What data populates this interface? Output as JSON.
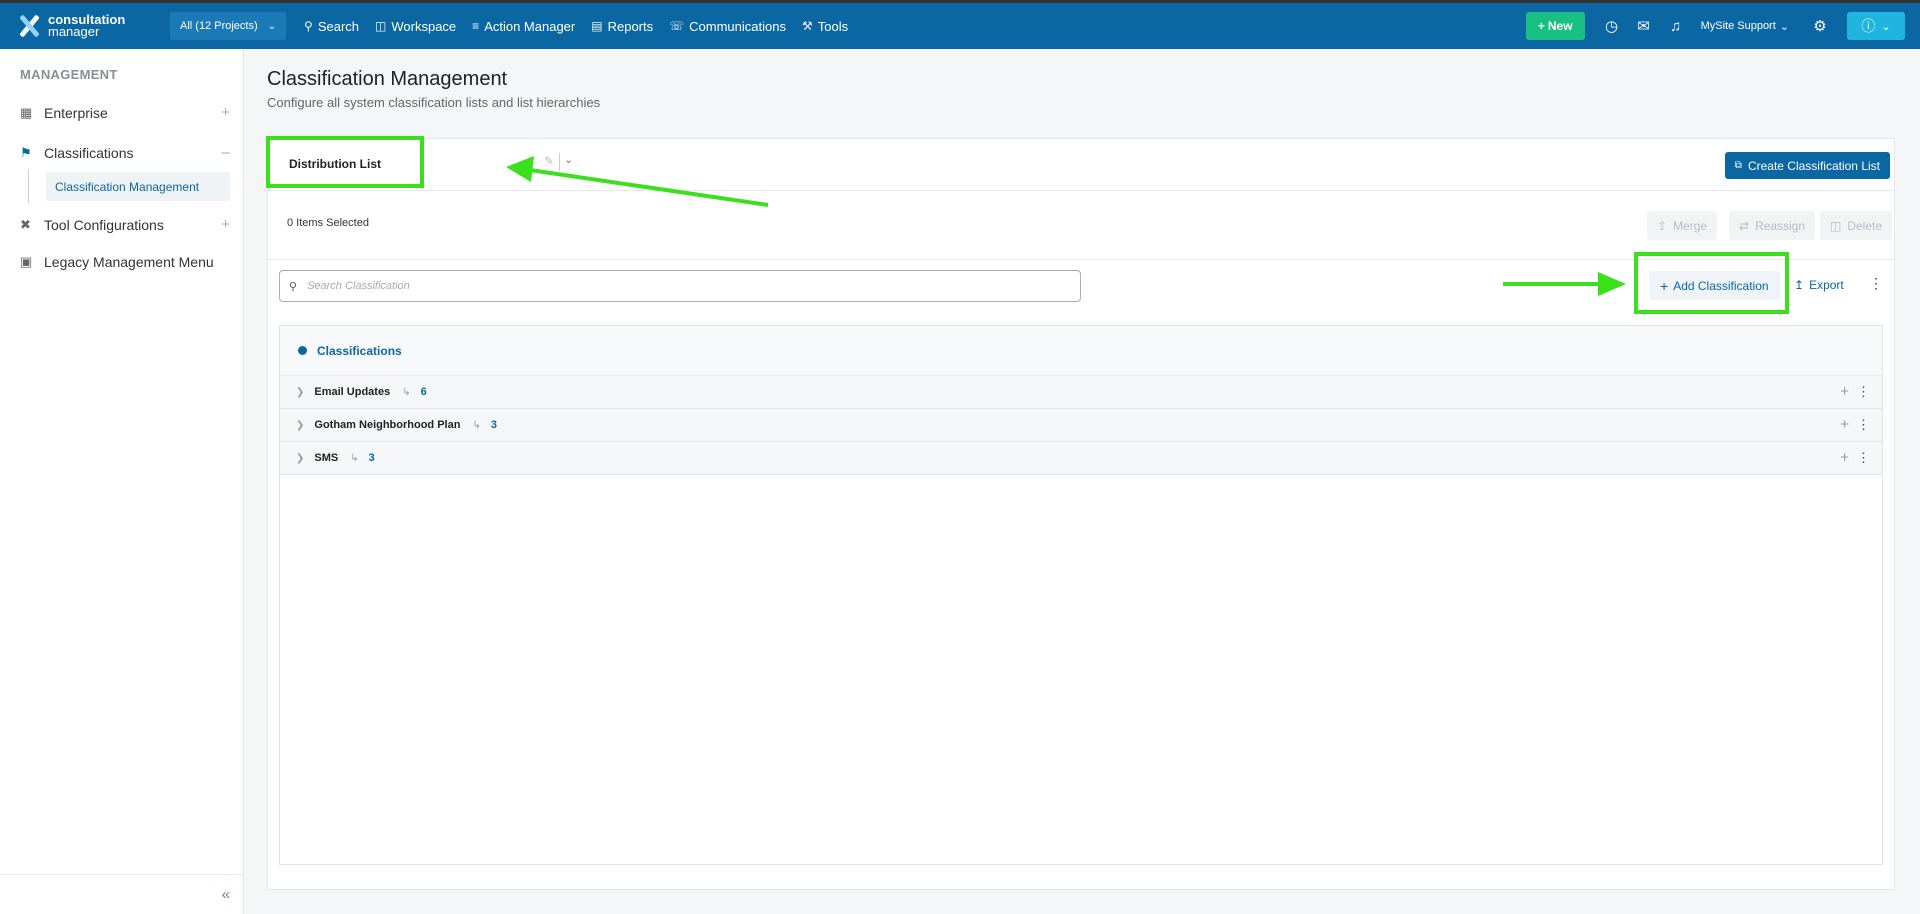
{
  "topbar": {
    "logo_line1": "consultation",
    "logo_line2": "manager",
    "project_selector": "All (12 Projects)",
    "nav": [
      {
        "label": "Search",
        "icon": "search-icon"
      },
      {
        "label": "Workspace",
        "icon": "workspace-icon"
      },
      {
        "label": "Action Manager",
        "icon": "list-icon"
      },
      {
        "label": "Reports",
        "icon": "document-icon"
      },
      {
        "label": "Communications",
        "icon": "communications-icon"
      },
      {
        "label": "Tools",
        "icon": "wrench-icon"
      }
    ],
    "new_label": "New",
    "user_label": "MySite Support"
  },
  "sidebar": {
    "heading": "MANAGEMENT",
    "items": [
      {
        "label": "Enterprise",
        "icon": "building-icon"
      },
      {
        "label": "Classifications",
        "icon": "tag-icon"
      },
      {
        "label": "Tool Configurations",
        "icon": "tools-icon"
      },
      {
        "label": "Legacy Management Menu",
        "icon": "file-icon"
      }
    ],
    "sub_item": "Classification Management"
  },
  "page": {
    "title": "Classification Management",
    "subtitle": "Configure all system classification lists and list hierarchies"
  },
  "card": {
    "list_name": "Distribution List",
    "create_button": "Create Classification List",
    "items_selected": "0 Items Selected",
    "actions": {
      "merge": "Merge",
      "reassign": "Reassign",
      "delete": "Delete"
    },
    "search_placeholder": "Search Classification",
    "add_button": "Add Classification",
    "export_button": "Export"
  },
  "tree": {
    "root_label": "Classifications",
    "rows": [
      {
        "name": "Email Updates",
        "count": "6"
      },
      {
        "name": "Gotham Neighborhood Plan",
        "count": "3"
      },
      {
        "name": "SMS",
        "count": "3"
      }
    ]
  },
  "colors": {
    "primary": "#0a67a3",
    "new_button": "#19c084",
    "help_button": "#1fb5e0",
    "annotation": "#3be01d"
  }
}
